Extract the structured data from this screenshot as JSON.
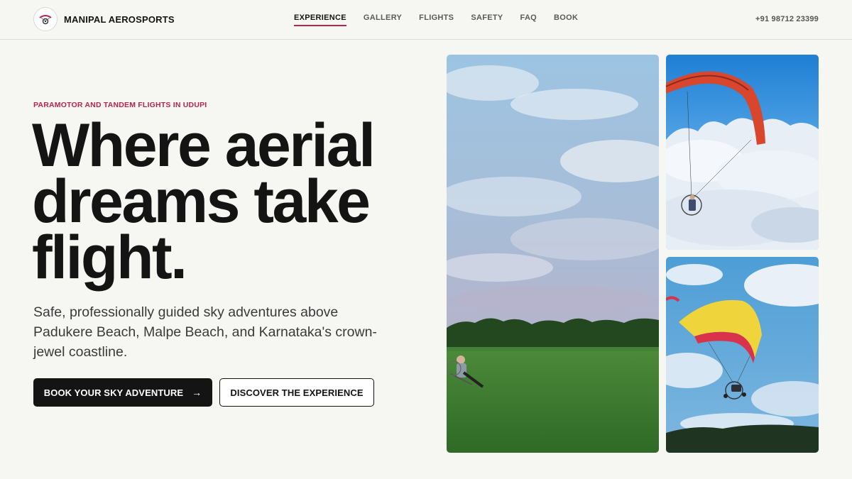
{
  "brand": {
    "name": "MANIPAL AEROSPORTS",
    "logo_icon": "paramotor-logo-icon"
  },
  "nav": {
    "items": [
      {
        "label": "EXPERIENCE",
        "active": true
      },
      {
        "label": "GALLERY",
        "active": false
      },
      {
        "label": "FLIGHTS",
        "active": false
      },
      {
        "label": "SAFETY",
        "active": false
      },
      {
        "label": "FAQ",
        "active": false
      },
      {
        "label": "BOOK",
        "active": false
      }
    ],
    "phone": "+91 98712 23399"
  },
  "hero": {
    "eyebrow": "PARAMOTOR AND TANDEM FLIGHTS IN UDUPI",
    "headline_line1": "Where aerial",
    "headline_line2": "dreams take",
    "headline_line3": "flight.",
    "subtext": "Safe, professionally guided sky adventures above Padukere Beach, Malpe Beach, and Karnataka's crown-jewel coastline.",
    "primary_cta": "BOOK YOUR SKY ADVENTURE",
    "primary_cta_icon": "arrow-right-icon",
    "secondary_cta": "DISCOVER THE EXPERIENCE"
  },
  "colors": {
    "accent": "#b5264d",
    "text": "#141414",
    "background": "#f6f6f2"
  }
}
